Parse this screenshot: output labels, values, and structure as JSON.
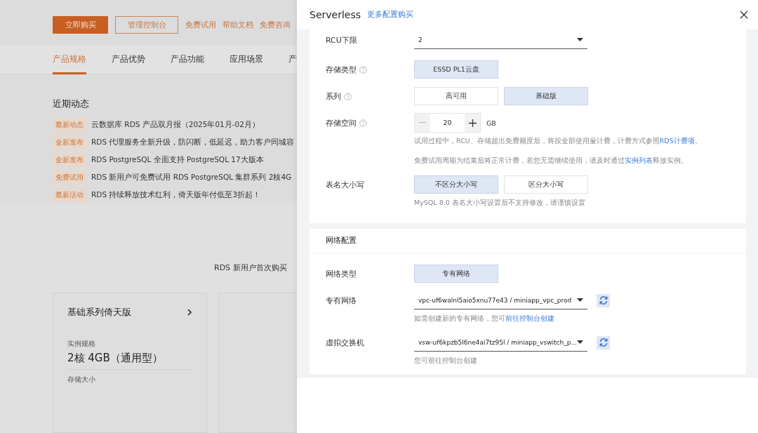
{
  "background_page": {
    "actions": [
      {
        "label": "立即购买",
        "kind": "primary"
      },
      {
        "label": "管理控制台",
        "kind": "outline"
      },
      {
        "label": "免费试用",
        "kind": "link"
      },
      {
        "label": "帮助文档",
        "kind": "link"
      },
      {
        "label": "免费咨询",
        "kind": "link"
      }
    ],
    "tabs": [
      {
        "label": "产品规格",
        "selected": true
      },
      {
        "label": "产品优势",
        "selected": false
      },
      {
        "label": "产品功能",
        "selected": false
      },
      {
        "label": "应用场景",
        "selected": false
      },
      {
        "label": "产",
        "selected": false
      }
    ],
    "news": {
      "title": "近期动态",
      "items": [
        {
          "tag": "最新动态",
          "text": "云数据库 RDS 产品双月报（2025年01月-02月）"
        },
        {
          "tag": "全新发布",
          "text": "RDS 代理服务全新升级，防闪断，低延迟，助力客户同城容"
        },
        {
          "tag": "全新发布",
          "text": "RDS PostgreSQL 全面支持 PostgreSQL 17大版本"
        },
        {
          "tag": "免费试用",
          "text": "RDS 新用户可免费试用 RDS PostgreSQL 集群系列 2核4G"
        },
        {
          "tag": "最新活动",
          "text": "RDS 持续释放技术红利，倚天版年付低至3折起！"
        }
      ]
    },
    "promo_text": "RDS 新用户首次购买",
    "plan_cards": [
      {
        "kind": "plan",
        "title": "基础系列倚天版",
        "spec_label": "实例规格",
        "spec_value": "2核 4GB（通用型）",
        "storage_label": "存储大小"
      },
      {
        "kind": "blank"
      }
    ]
  },
  "drawer": {
    "title": "Serverless",
    "link": "更多配置购买",
    "sections": [
      {
        "rows": [
          {
            "kind": "select",
            "label": "RCU下限",
            "value": "2"
          },
          {
            "kind": "options",
            "label": "存储类型",
            "help": true,
            "options": [
              {
                "label": "ESSD PL1云盘",
                "selected": true
              }
            ]
          },
          {
            "kind": "options",
            "label": "系列",
            "help": true,
            "options": [
              {
                "label": "高可用",
                "selected": false
              },
              {
                "label": "基础版",
                "selected": true
              }
            ]
          },
          {
            "kind": "stepper",
            "label": "存储空间",
            "help": true,
            "value": "20",
            "unit": "GB",
            "notes": [
              [
                {
                  "text": "试用过程中，RCU、存储超出免费额度后，将按全部使用量计费，计费方式参照",
                  "kind": "text"
                },
                {
                  "text": "RDS计费项",
                  "kind": "link"
                },
                {
                  "text": "。",
                  "kind": "text"
                }
              ],
              [
                {
                  "text": "免费试用周期为结束后将正常计费，若您无需继续使用，请及时通过",
                  "kind": "text"
                },
                {
                  "text": "实例列表",
                  "kind": "link"
                },
                {
                  "text": "释放实例。",
                  "kind": "text"
                }
              ]
            ]
          },
          {
            "kind": "options",
            "label": "表名大小写",
            "options": [
              {
                "label": "不区分大小写",
                "selected": true
              },
              {
                "label": "区分大小写",
                "selected": false
              }
            ],
            "notes": [
              [
                {
                  "text": "MySQL 8.0 表名大小写设置后不支持修改，请谨慎设置",
                  "kind": "text"
                }
              ]
            ]
          }
        ]
      },
      {
        "heading": "网络配置",
        "rows": [
          {
            "kind": "options",
            "label": "网络类型",
            "options": [
              {
                "label": "专有网络",
                "selected": true
              }
            ]
          },
          {
            "kind": "select",
            "label": "专有网络",
            "value": "vpc-uf6walnl5aio5xnu77e43 / miniapp_vpc_prod",
            "refresh": true,
            "notes": [
              [
                {
                  "text": "如需创建新的专有网络，您可",
                  "kind": "text"
                },
                {
                  "text": "前往控制台创建",
                  "kind": "link"
                }
              ]
            ]
          },
          {
            "kind": "select",
            "label": "虚拟交换机",
            "value": "vsw-uf6kpzb5l6ne4ai7tz95l / miniapp_vswitch_p...",
            "refresh": true,
            "notes": [
              [
                {
                  "text": "您可前往控制台创建",
                  "kind": "text"
                }
              ]
            ]
          }
        ]
      }
    ]
  }
}
